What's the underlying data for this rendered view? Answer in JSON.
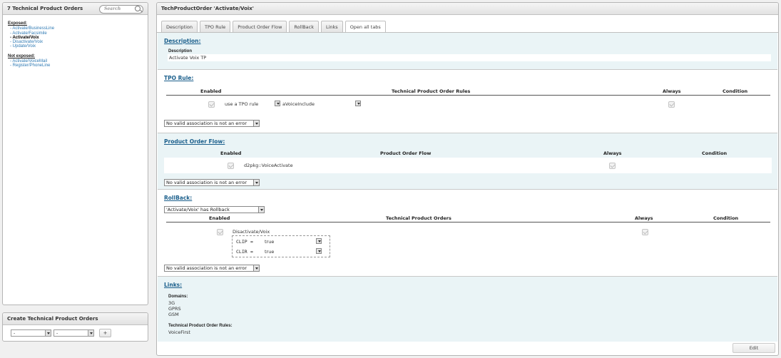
{
  "left_panel": {
    "title": "7 Technical Product Orders",
    "search_placeholder": "Search",
    "exposed_label": "Exposed:",
    "exposed_items": [
      "- Activate/BusinessLine",
      "- Activate/Facsimile",
      "- Activate/Voix",
      "- Disactivate/Voix",
      "- Update/Voix"
    ],
    "active_item": "- Activate/Voix",
    "not_exposed_label": "Not exposed:",
    "not_exposed_items": [
      "- Activate/VoiceMail",
      "- Register/PhoneLine"
    ]
  },
  "create_panel": {
    "title": "Create Technical Product Orders",
    "select1_value": "-",
    "select2_value": "-",
    "add_label": "+"
  },
  "main": {
    "title": "TechProductOrder 'Activate/Voix'",
    "tabs": [
      "Description",
      "TPO Rule",
      "Product Order Flow",
      "RollBack",
      "Links",
      "Open all tabs"
    ],
    "active_tab": "Open all tabs",
    "description": {
      "title": "Description:",
      "label": "Description",
      "value": "Activate Voix TP"
    },
    "tpo_rule": {
      "title": "TPO Rule:",
      "headers": [
        "Enabled",
        "Technical Product Order Rules",
        "Always",
        "Condition"
      ],
      "rule_text": "use a TPO rule",
      "rule_select": "aVoiceInclude",
      "assoc_select": "No valid association is not an error"
    },
    "pof": {
      "title": "Product Order Flow:",
      "headers": [
        "Enabled",
        "Product Order Flow",
        "Always",
        "Condition"
      ],
      "flow": "d2pkg::VoiceActivate",
      "assoc_select": "No valid association is not an error"
    },
    "rollback": {
      "title": "RollBack:",
      "has_select": "'Activate/Voix' has Rollback",
      "headers": [
        "Enabled",
        "Technical Product Orders",
        "Always",
        "Condition"
      ],
      "order": "Disactivate/Voix",
      "conditions": [
        {
          "key": "CLIP",
          "op": "=",
          "value": "true"
        },
        {
          "key": "CLIR",
          "op": "=",
          "value": "true"
        }
      ],
      "assoc_select": "No valid association is not an error"
    },
    "links": {
      "title": "Links:",
      "domains_label": "Domains:",
      "domains": [
        "3G",
        "GPRS",
        "GSM"
      ],
      "rules_label": "Technical Product Order Rules:",
      "rules": [
        "VoiceFirst"
      ]
    },
    "edit_label": "Edit"
  }
}
